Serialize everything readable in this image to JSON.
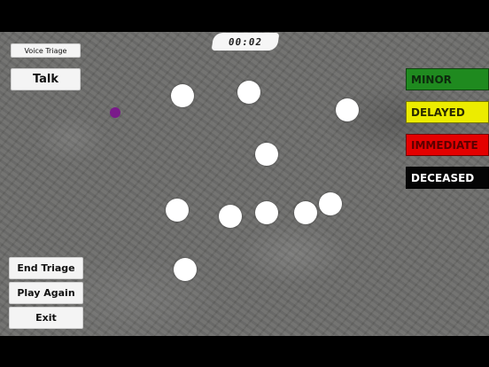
{
  "hud": {
    "voice_label": "Voice Triage",
    "talk_label": "Talk",
    "timer": "00:02"
  },
  "menu": {
    "end_label": "End Triage",
    "again_label": "Play Again",
    "exit_label": "Exit"
  },
  "triage_tags": [
    {
      "label": "MINOR",
      "bg": "#1f8a1f",
      "fg": "#0d2a0d"
    },
    {
      "label": "DELAYED",
      "bg": "#ecec00",
      "fg": "#2a2a00"
    },
    {
      "label": "IMMEDIATE",
      "bg": "#e40000",
      "fg": "#5a0000"
    },
    {
      "label": "DECEASED",
      "bg": "#050505",
      "fg": "#ffffff"
    }
  ],
  "colors": {
    "player": "#7a1a8a",
    "victim": "#ffffff"
  }
}
